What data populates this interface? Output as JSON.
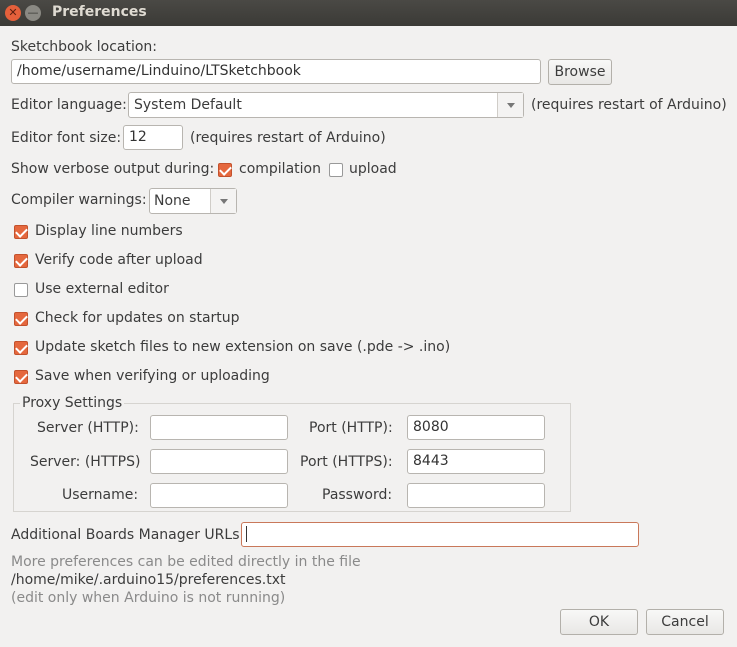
{
  "window": {
    "title": "Preferences"
  },
  "sketchbook": {
    "label": "Sketchbook location:",
    "value": "/home/username/Linduino/LTSketchbook",
    "browse": "Browse"
  },
  "language": {
    "label": "Editor language:",
    "value": "System Default",
    "note": "(requires restart of Arduino)"
  },
  "font": {
    "label": "Editor font size:",
    "value": "12",
    "note": "(requires restart of Arduino)"
  },
  "verbose": {
    "label": "Show verbose output during:",
    "compilation": "compilation",
    "upload": "upload"
  },
  "warnings": {
    "label": "Compiler warnings:",
    "value": "None"
  },
  "checks": [
    {
      "label": "Display line numbers",
      "checked": true
    },
    {
      "label": "Verify code after upload",
      "checked": true
    },
    {
      "label": "Use external editor",
      "checked": false
    },
    {
      "label": "Check for updates on startup",
      "checked": true
    },
    {
      "label": "Update sketch files to new extension on save (.pde -> .ino)",
      "checked": true
    },
    {
      "label": "Save when verifying or uploading",
      "checked": true
    }
  ],
  "proxy": {
    "title": "Proxy Settings",
    "server_http": "Server (HTTP):",
    "port_http": "Port (HTTP):",
    "port_http_value": "8080",
    "server_https": "Server: (HTTPS)",
    "port_https": "Port (HTTPS):",
    "port_https_value": "8443",
    "username": "Username:",
    "password": "Password:"
  },
  "boards": {
    "label": "Additional Boards Manager URLs:",
    "value": ""
  },
  "footer": {
    "more": "More preferences can be edited directly in the file",
    "path": "/home/mike/.arduino15/preferences.txt",
    "note": "(edit only when Arduino is not running)"
  },
  "buttons": {
    "ok": "OK",
    "cancel": "Cancel"
  }
}
